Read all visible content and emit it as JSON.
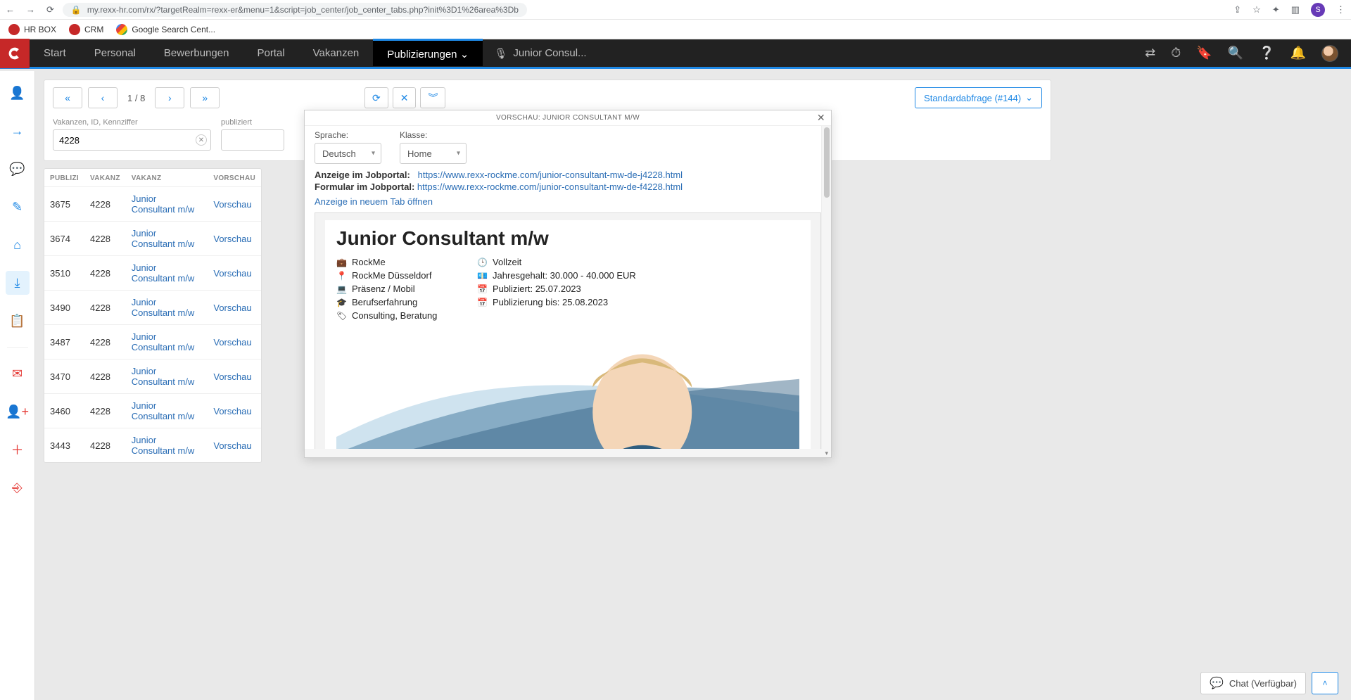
{
  "chrome": {
    "url": "my.rexx-hr.com/rx/?targetRealm=rexx-er&menu=1&script=job_center/job_center_tabs.php?init%3D1%26area%3Db",
    "avatar_letter": "S",
    "bookmarks": [
      "HR BOX",
      "CRM",
      "Google Search Cent..."
    ]
  },
  "nav": {
    "items": [
      "Start",
      "Personal",
      "Bewerbungen",
      "Portal",
      "Vakanzen",
      "Publizierungen"
    ],
    "active": "Publizierungen",
    "breadcrumb": "Junior Consul..."
  },
  "toolbar": {
    "page_label": "1 / 8",
    "query_button": "Standardabfrage (#144)"
  },
  "filters": {
    "vacancy_label": "Vakanzen, ID, Kennziffer",
    "vacancy_value": "4228",
    "published_label": "publiziert"
  },
  "table": {
    "headers": {
      "publizi": "PUBLIZI",
      "vakanz_id": "VAKANZ",
      "vakanz": "VAKANZ",
      "vorschau": "VORSCHAU"
    },
    "preview_label": "Vorschau",
    "job_title": "Junior Consultant m/w",
    "rows": [
      {
        "publizi": "3675",
        "vakanz_id": "4228"
      },
      {
        "publizi": "3674",
        "vakanz_id": "4228"
      },
      {
        "publizi": "3510",
        "vakanz_id": "4228"
      },
      {
        "publizi": "3490",
        "vakanz_id": "4228"
      },
      {
        "publizi": "3487",
        "vakanz_id": "4228"
      },
      {
        "publizi": "3470",
        "vakanz_id": "4228"
      },
      {
        "publizi": "3460",
        "vakanz_id": "4228"
      },
      {
        "publizi": "3443",
        "vakanz_id": "4228"
      }
    ]
  },
  "preview": {
    "title": "VORSCHAU: JUNIOR CONSULTANT M/W",
    "sprache_label": "Sprache:",
    "sprache_value": "Deutsch",
    "klasse_label": "Klasse:",
    "klasse_value": "Home",
    "link1_label": "Anzeige im Jobportal:",
    "link1_url": "https://www.rexx-rockme.com/junior-consultant-mw-de-j4228.html",
    "link2_label": "Formular im Jobportal:",
    "link2_url": "https://www.rexx-rockme.com/junior-consultant-mw-de-f4228.html",
    "open_tab": "Anzeige in neuem Tab öffnen",
    "job": {
      "title": "Junior Consultant m/w",
      "company": "RockMe",
      "location": "RockMe Düsseldorf",
      "presence": "Präsenz / Mobil",
      "experience": "Berufserfahrung",
      "category": "Consulting, Beratung",
      "employment": "Vollzeit",
      "salary": "Jahresgehalt: 30.000 - 40.000 EUR",
      "published": "Publiziert: 25.07.2023",
      "published_until": "Publizierung bis: 25.08.2023"
    }
  },
  "chat": {
    "label": "Chat (Verfügbar)"
  }
}
